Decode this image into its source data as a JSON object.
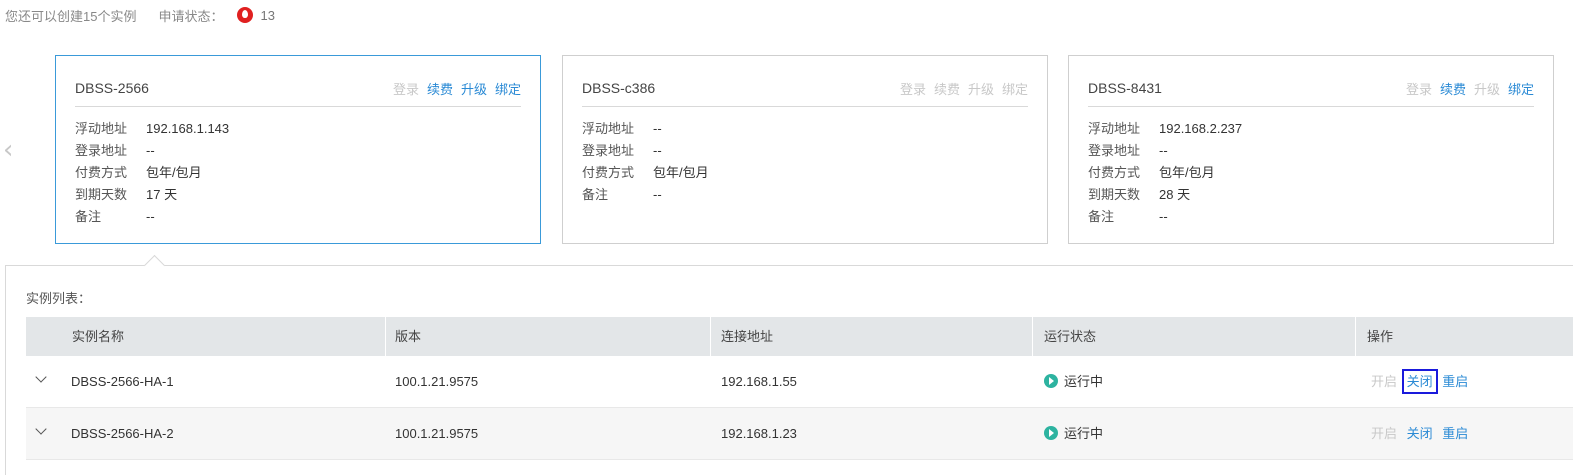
{
  "topbar": {
    "quota_text": "您还可以创建15个实例",
    "status_label": "申请状态：",
    "status_count": "13"
  },
  "cards": [
    {
      "title": "DBSS-2566",
      "actions": [
        {
          "label": "登录",
          "enabled": false
        },
        {
          "label": "续费",
          "enabled": true
        },
        {
          "label": "升级",
          "enabled": true
        },
        {
          "label": "绑定",
          "enabled": true
        }
      ],
      "fields": [
        {
          "key": "浮动地址",
          "value": "192.168.1.143"
        },
        {
          "key": "登录地址",
          "value": "--"
        },
        {
          "key": "付费方式",
          "value": "包年/包月"
        },
        {
          "key": "到期天数",
          "value": "17 天"
        },
        {
          "key": "备注",
          "value": "--"
        }
      ]
    },
    {
      "title": "DBSS-c386",
      "actions": [
        {
          "label": "登录",
          "enabled": false
        },
        {
          "label": "续费",
          "enabled": false
        },
        {
          "label": "升级",
          "enabled": false
        },
        {
          "label": "绑定",
          "enabled": false
        }
      ],
      "fields": [
        {
          "key": "浮动地址",
          "value": "--"
        },
        {
          "key": "登录地址",
          "value": "--"
        },
        {
          "key": "付费方式",
          "value": "包年/包月"
        },
        {
          "key": "备注",
          "value": "--"
        }
      ]
    },
    {
      "title": "DBSS-8431",
      "actions": [
        {
          "label": "登录",
          "enabled": false
        },
        {
          "label": "续费",
          "enabled": true
        },
        {
          "label": "升级",
          "enabled": false
        },
        {
          "label": "绑定",
          "enabled": true
        }
      ],
      "fields": [
        {
          "key": "浮动地址",
          "value": "192.168.2.237"
        },
        {
          "key": "登录地址",
          "value": "--"
        },
        {
          "key": "付费方式",
          "value": "包年/包月"
        },
        {
          "key": "到期天数",
          "value": "28 天"
        },
        {
          "key": "备注",
          "value": "--"
        }
      ]
    }
  ],
  "instance_list": {
    "label": "实例列表：",
    "headers": [
      "实例名称",
      "版本",
      "连接地址",
      "运行状态",
      "操作"
    ],
    "rows": [
      {
        "name": "DBSS-2566-HA-1",
        "version": "100.1.21.9575",
        "address": "192.168.1.55",
        "status": "运行中",
        "ops": [
          {
            "label": "开启",
            "enabled": false
          },
          {
            "label": "关闭",
            "enabled": true,
            "highlighted": true
          },
          {
            "label": "重启",
            "enabled": true
          }
        ]
      },
      {
        "name": "DBSS-2566-HA-2",
        "version": "100.1.21.9575",
        "address": "192.168.1.23",
        "status": "运行中",
        "ops": [
          {
            "label": "开启",
            "enabled": false
          },
          {
            "label": "关闭",
            "enabled": true
          },
          {
            "label": "重启",
            "enabled": true
          }
        ]
      }
    ]
  },
  "icons": {
    "status_flame": "flame-icon",
    "prev": "chevron-left-icon",
    "expand": "chevron-down-icon",
    "running": "play-circle-icon"
  },
  "colors": {
    "accent": "#2a8ad5",
    "disabled": "#c8c8c8",
    "danger": "#e02020",
    "running": "#2db3a0",
    "highlight": "#1a1adc"
  }
}
